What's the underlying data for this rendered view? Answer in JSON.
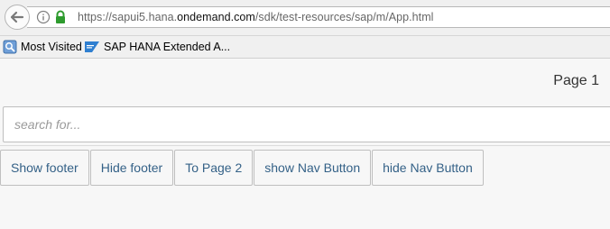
{
  "browser": {
    "url_prefix": "https://sapui5.hana.",
    "url_domain": "ondemand.com",
    "url_path": "/sdk/test-resources/sap/m/App.html"
  },
  "bookmarks": [
    {
      "label": "Most Visited",
      "icon": "most-visited-icon"
    },
    {
      "label": "SAP HANA Extended A...",
      "icon": "sap-icon"
    }
  ],
  "page": {
    "title": "Page 1"
  },
  "search": {
    "placeholder": "search for...",
    "value": ""
  },
  "buttons": [
    {
      "label": "Show footer"
    },
    {
      "label": "Hide footer"
    },
    {
      "label": "To Page 2"
    },
    {
      "label": "show Nav Button"
    },
    {
      "label": "hide Nav Button"
    }
  ],
  "colors": {
    "button_text": "#346187",
    "background": "#f7f7f7"
  }
}
